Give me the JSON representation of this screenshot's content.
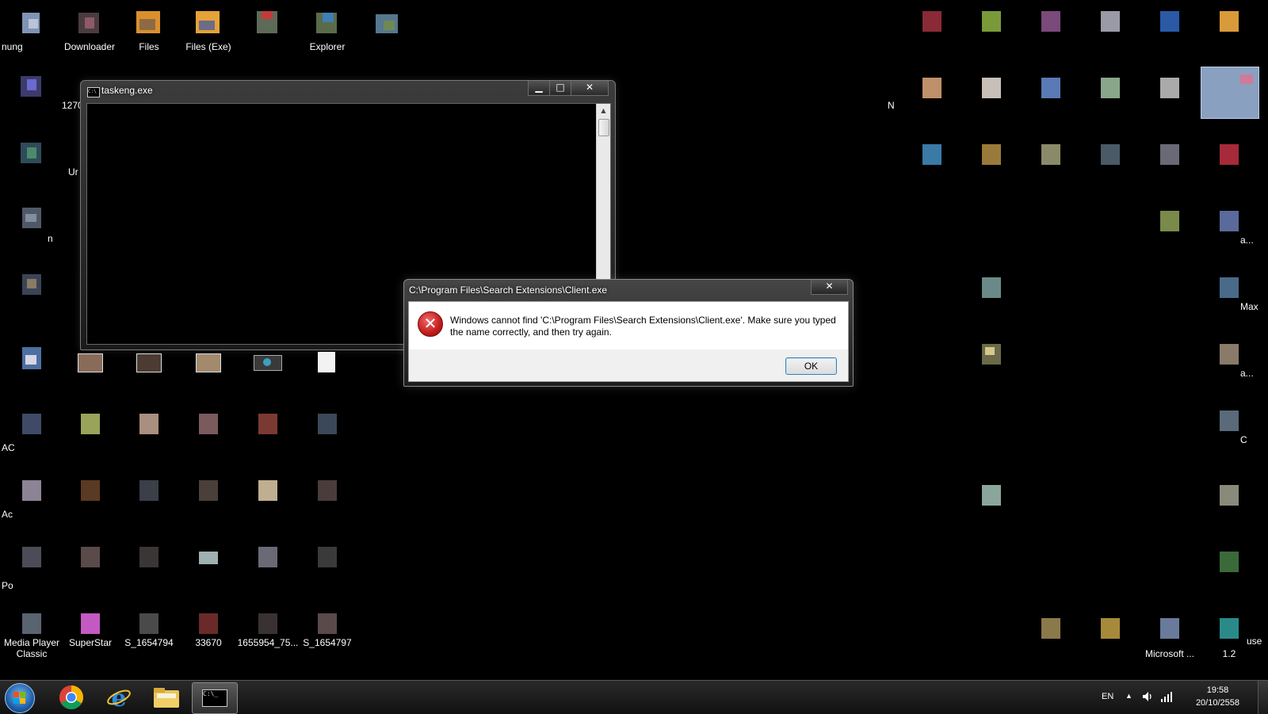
{
  "desktop": {
    "labeled_icons": [
      {
        "label": "Media Player Classic"
      },
      {
        "label": "SuperStar"
      },
      {
        "label": "S_1654794"
      },
      {
        "label": "33670"
      },
      {
        "label": "1655954_75..."
      },
      {
        "label": "S_1654797"
      },
      {
        "label": "Microsoft ..."
      },
      {
        "label": "1.2"
      }
    ],
    "partial_labels": [
      "nung",
      "Downloader",
      "Files",
      "Files (Exe)",
      "Explorer",
      "1270",
      "Ur",
      "n",
      "AC",
      "Ac",
      "Po",
      "a...",
      "Max",
      "a...",
      "C",
      "use",
      "N"
    ]
  },
  "console_window": {
    "title": "taskeng.exe",
    "icon_text": "C:\\",
    "minimize": "▁",
    "maximize": "□",
    "close": "✕"
  },
  "error_dialog": {
    "title": "C:\\Program Files\\Search Extensions\\Client.exe",
    "close": "✕",
    "icon": "error-x-icon",
    "icon_glyph": "✕",
    "message": "Windows cannot find 'C:\\Program Files\\Search Extensions\\Client.exe'. Make sure you typed the name correctly, and then try again.",
    "ok_label": "OK"
  },
  "taskbar": {
    "pinned": [
      {
        "name": "chrome-icon"
      },
      {
        "name": "internet-explorer-icon"
      },
      {
        "name": "windows-explorer-icon"
      },
      {
        "name": "command-prompt-icon"
      }
    ],
    "language": "EN",
    "tray_arrow": "▲",
    "time": "19:58",
    "date": "20/10/2558"
  }
}
